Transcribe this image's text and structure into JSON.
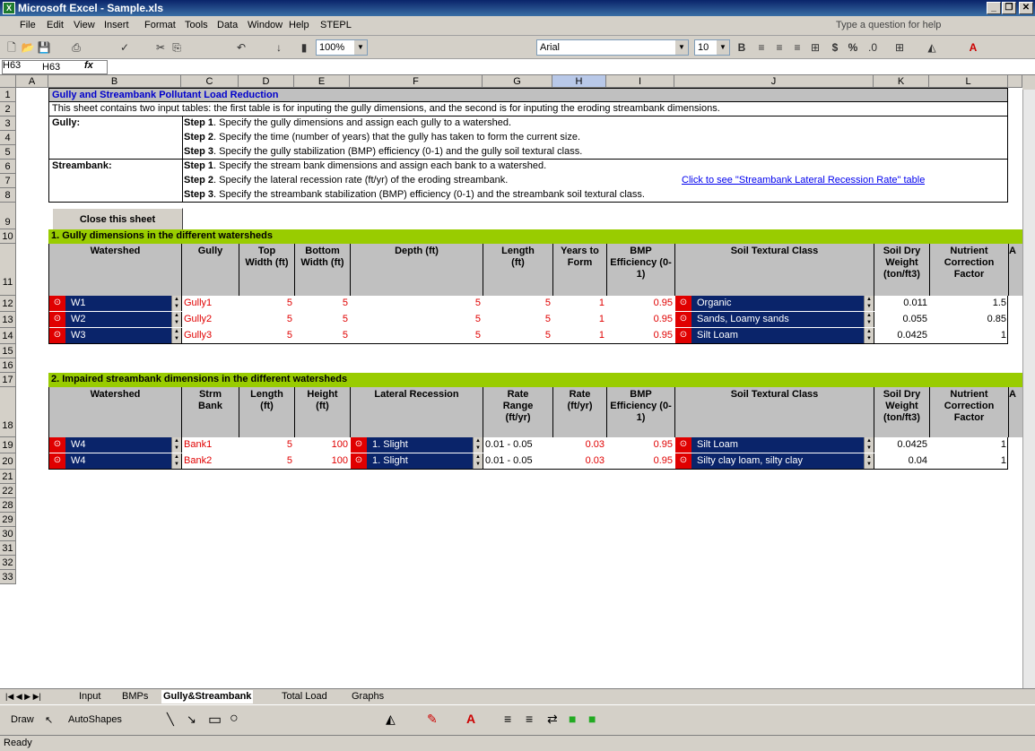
{
  "window": {
    "title": "Microsoft Excel - Sample.xls",
    "help_placeholder": "Type a question for help"
  },
  "menu": [
    "File",
    "Edit",
    "View",
    "Insert",
    "Format",
    "Tools",
    "Data",
    "Window",
    "Help",
    "STEPL"
  ],
  "toolbar": {
    "zoom": "100%",
    "font": "Arial",
    "font_size": "10"
  },
  "formula_bar": {
    "name_box": "H63",
    "fx": "fx"
  },
  "columns": [
    "A",
    "B",
    "C",
    "D",
    "E",
    "F",
    "G",
    "H",
    "I",
    "J",
    "K",
    "L"
  ],
  "rows": [
    "1",
    "2",
    "3",
    "4",
    "5",
    "6",
    "7",
    "8",
    "9",
    "10",
    "11",
    "12",
    "13",
    "14",
    "15",
    "16",
    "17",
    "18",
    "19",
    "20",
    "21",
    "22",
    "28",
    "29",
    "30",
    "31",
    "32",
    "33"
  ],
  "sheet": {
    "title": "Gully and Streambank Pollutant Load Reduction",
    "intro": "This sheet contains two input tables: the first table is for inputing the gully dimensions, and the second is for inputing the eroding streambank dimensions.",
    "gully_label": "Gully:",
    "stream_label": "Streambank:",
    "step_word": [
      "Step 1",
      "Step 2",
      "Step 3"
    ],
    "gully_steps": [
      ". Specify the gully dimensions and assign each gully to a watershed.",
      ". Specify the time (number of years) that the gully has taken to form the current size.",
      ". Specify the gully stabilization (BMP) efficiency (0-1) and the gully soil textural class."
    ],
    "stream_steps": [
      ". Specify the stream bank dimensions and assign each bank to a watershed.",
      ". Specify the lateral recession rate (ft/yr) of the eroding streambank.",
      ". Specify the streambank stabilization (BMP) efficiency (0-1) and the streambank soil textural class."
    ],
    "link": "Click to see \"Streambank Lateral Recession Rate\" table",
    "close_button": "Close this sheet",
    "gully_section": "1. Gully dimensions in the different watersheds",
    "gully_headers": [
      "Watershed",
      "Gully",
      "Top Width (ft)",
      "Bottom Width (ft)",
      "Depth (ft)",
      "Length (ft)",
      "Years to Form",
      "BMP Efficiency (0-1)",
      "Soil Textural Class",
      "Soil Dry Weight (ton/ft3)",
      "Nutrient Correction Factor"
    ],
    "gully_rows": [
      {
        "ws": "W1",
        "name": "Gully1",
        "top": "5",
        "bottom": "5",
        "depth": "5",
        "length": "5",
        "years": "1",
        "bmp": "0.95",
        "soil": "Organic",
        "dry": "0.011",
        "ncf": "1.5"
      },
      {
        "ws": "W2",
        "name": "Gully2",
        "top": "5",
        "bottom": "5",
        "depth": "5",
        "length": "5",
        "years": "1",
        "bmp": "0.95",
        "soil": "Sands, Loamy sands",
        "dry": "0.055",
        "ncf": "0.85"
      },
      {
        "ws": "W3",
        "name": "Gully3",
        "top": "5",
        "bottom": "5",
        "depth": "5",
        "length": "5",
        "years": "1",
        "bmp": "0.95",
        "soil": "Silt Loam",
        "dry": "0.0425",
        "ncf": "1"
      }
    ],
    "stream_section": "2. Impaired streambank dimensions in the different watersheds",
    "stream_headers": [
      "Watershed",
      "Strm Bank",
      "Length (ft)",
      "Height (ft)",
      "Lateral Recession",
      "Rate Range (ft/yr)",
      "Rate (ft/yr)",
      "BMP Efficiency (0-1)",
      "Soil Textural Class",
      "Soil Dry Weight (ton/ft3)",
      "Nutrient Correction Factor"
    ],
    "stream_rows": [
      {
        "ws": "W4",
        "name": "Bank1",
        "length": "5",
        "height": "100",
        "lat": "1. Slight",
        "range": "0.01 - 0.05",
        "rate": "0.03",
        "bmp": "0.95",
        "soil": "Silt Loam",
        "dry": "0.0425",
        "ncf": "1"
      },
      {
        "ws": "W4",
        "name": "Bank2",
        "length": "5",
        "height": "100",
        "lat": "1. Slight",
        "range": "0.01 - 0.05",
        "rate": "0.03",
        "bmp": "0.95",
        "soil": "Silty clay loam, silty clay",
        "dry": "0.04",
        "ncf": "1"
      }
    ],
    "cut_header": "A"
  },
  "tabs": [
    "Input",
    "BMPs",
    "Gully&Streambank",
    "Total Load",
    "Graphs"
  ],
  "active_tab": "Gully&Streambank",
  "draw": {
    "draw": "Draw",
    "autoshapes": "AutoShapes"
  },
  "status": "Ready"
}
